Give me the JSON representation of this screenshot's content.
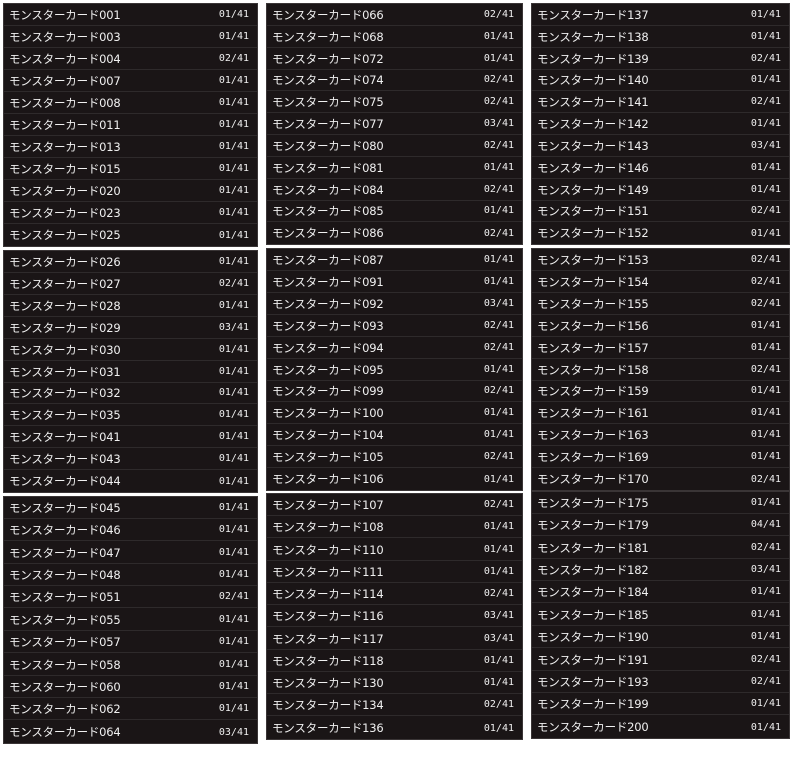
{
  "columns": [
    {
      "panels": [
        {
          "rows": [
            {
              "name": "モンスターカード001",
              "count": "01/41"
            },
            {
              "name": "モンスターカード003",
              "count": "01/41"
            },
            {
              "name": "モンスターカード004",
              "count": "02/41"
            },
            {
              "name": "モンスターカード007",
              "count": "01/41"
            },
            {
              "name": "モンスターカード008",
              "count": "01/41"
            },
            {
              "name": "モンスターカード011",
              "count": "01/41"
            },
            {
              "name": "モンスターカード013",
              "count": "01/41"
            },
            {
              "name": "モンスターカード015",
              "count": "01/41"
            },
            {
              "name": "モンスターカード020",
              "count": "01/41"
            },
            {
              "name": "モンスターカード023",
              "count": "01/41"
            },
            {
              "name": "モンスターカード025",
              "count": "01/41"
            }
          ]
        },
        {
          "rows": [
            {
              "name": "モンスターカード026",
              "count": "01/41"
            },
            {
              "name": "モンスターカード027",
              "count": "02/41"
            },
            {
              "name": "モンスターカード028",
              "count": "01/41"
            },
            {
              "name": "モンスターカード029",
              "count": "03/41"
            },
            {
              "name": "モンスターカード030",
              "count": "01/41"
            },
            {
              "name": "モンスターカード031",
              "count": "01/41"
            },
            {
              "name": "モンスターカード032",
              "count": "01/41"
            },
            {
              "name": "モンスターカード035",
              "count": "01/41"
            },
            {
              "name": "モンスターカード041",
              "count": "01/41"
            },
            {
              "name": "モンスターカード043",
              "count": "01/41"
            },
            {
              "name": "モンスターカード044",
              "count": "01/41"
            }
          ]
        },
        {
          "rows": [
            {
              "name": "モンスターカード045",
              "count": "01/41"
            },
            {
              "name": "モンスターカード046",
              "count": "01/41"
            },
            {
              "name": "モンスターカード047",
              "count": "01/41"
            },
            {
              "name": "モンスターカード048",
              "count": "01/41"
            },
            {
              "name": "モンスターカード051",
              "count": "02/41"
            },
            {
              "name": "モンスターカード055",
              "count": "01/41"
            },
            {
              "name": "モンスターカード057",
              "count": "01/41"
            },
            {
              "name": "モンスターカード058",
              "count": "01/41"
            },
            {
              "name": "モンスターカード060",
              "count": "01/41"
            },
            {
              "name": "モンスターカード062",
              "count": "01/41"
            },
            {
              "name": "モンスターカード064",
              "count": "03/41"
            }
          ]
        }
      ]
    },
    {
      "panels": [
        {
          "rows": [
            {
              "name": "モンスターカード066",
              "count": "02/41"
            },
            {
              "name": "モンスターカード068",
              "count": "01/41"
            },
            {
              "name": "モンスターカード072",
              "count": "01/41"
            },
            {
              "name": "モンスターカード074",
              "count": "02/41"
            },
            {
              "name": "モンスターカード075",
              "count": "02/41"
            },
            {
              "name": "モンスターカード077",
              "count": "03/41"
            },
            {
              "name": "モンスターカード080",
              "count": "02/41"
            },
            {
              "name": "モンスターカード081",
              "count": "01/41"
            },
            {
              "name": "モンスターカード084",
              "count": "02/41"
            },
            {
              "name": "モンスターカード085",
              "count": "01/41"
            },
            {
              "name": "モンスターカード086",
              "count": "02/41"
            }
          ]
        },
        {
          "rows": [
            {
              "name": "モンスターカード087",
              "count": "01/41"
            },
            {
              "name": "モンスターカード091",
              "count": "01/41"
            },
            {
              "name": "モンスターカード092",
              "count": "03/41"
            },
            {
              "name": "モンスターカード093",
              "count": "02/41"
            },
            {
              "name": "モンスターカード094",
              "count": "02/41"
            },
            {
              "name": "モンスターカード095",
              "count": "01/41"
            },
            {
              "name": "モンスターカード099",
              "count": "02/41"
            },
            {
              "name": "モンスターカード100",
              "count": "01/41"
            },
            {
              "name": "モンスターカード104",
              "count": "01/41"
            },
            {
              "name": "モンスターカード105",
              "count": "02/41"
            },
            {
              "name": "モンスターカード106",
              "count": "01/41"
            }
          ]
        },
        {
          "rows": [
            {
              "name": "モンスターカード107",
              "count": "02/41"
            },
            {
              "name": "モンスターカード108",
              "count": "01/41"
            },
            {
              "name": "モンスターカード110",
              "count": "01/41"
            },
            {
              "name": "モンスターカード111",
              "count": "01/41"
            },
            {
              "name": "モンスターカード114",
              "count": "02/41"
            },
            {
              "name": "モンスターカード116",
              "count": "03/41"
            },
            {
              "name": "モンスターカード117",
              "count": "03/41"
            },
            {
              "name": "モンスターカード118",
              "count": "01/41"
            },
            {
              "name": "モンスターカード130",
              "count": "01/41"
            },
            {
              "name": "モンスターカード134",
              "count": "02/41"
            },
            {
              "name": "モンスターカード136",
              "count": "01/41"
            }
          ]
        }
      ]
    },
    {
      "panels": [
        {
          "rows": [
            {
              "name": "モンスターカード137",
              "count": "01/41"
            },
            {
              "name": "モンスターカード138",
              "count": "01/41"
            },
            {
              "name": "モンスターカード139",
              "count": "02/41"
            },
            {
              "name": "モンスターカード140",
              "count": "01/41"
            },
            {
              "name": "モンスターカード141",
              "count": "02/41"
            },
            {
              "name": "モンスターカード142",
              "count": "01/41"
            },
            {
              "name": "モンスターカード143",
              "count": "03/41"
            },
            {
              "name": "モンスターカード146",
              "count": "01/41"
            },
            {
              "name": "モンスターカード149",
              "count": "01/41"
            },
            {
              "name": "モンスターカード151",
              "count": "02/41"
            },
            {
              "name": "モンスターカード152",
              "count": "01/41"
            }
          ]
        },
        {
          "rows": [
            {
              "name": "モンスターカード153",
              "count": "02/41"
            },
            {
              "name": "モンスターカード154",
              "count": "02/41"
            },
            {
              "name": "モンスターカード155",
              "count": "02/41"
            },
            {
              "name": "モンスターカード156",
              "count": "01/41"
            },
            {
              "name": "モンスターカード157",
              "count": "01/41"
            },
            {
              "name": "モンスターカード158",
              "count": "02/41"
            },
            {
              "name": "モンスターカード159",
              "count": "01/41"
            },
            {
              "name": "モンスターカード161",
              "count": "01/41"
            },
            {
              "name": "モンスターカード163",
              "count": "01/41"
            },
            {
              "name": "モンスターカード169",
              "count": "01/41"
            },
            {
              "name": "モンスターカード170",
              "count": "02/41"
            }
          ]
        },
        {
          "rows": [
            {
              "name": "モンスターカード175",
              "count": "01/41"
            },
            {
              "name": "モンスターカード179",
              "count": "04/41"
            },
            {
              "name": "モンスターカード181",
              "count": "02/41"
            },
            {
              "name": "モンスターカード182",
              "count": "03/41"
            },
            {
              "name": "モンスターカード184",
              "count": "01/41"
            },
            {
              "name": "モンスターカード185",
              "count": "01/41"
            },
            {
              "name": "モンスターカード190",
              "count": "01/41"
            },
            {
              "name": "モンスターカード191",
              "count": "02/41"
            },
            {
              "name": "モンスターカード193",
              "count": "02/41"
            },
            {
              "name": "モンスターカード199",
              "count": "01/41"
            },
            {
              "name": "モンスターカード200",
              "count": "01/41"
            }
          ]
        }
      ]
    }
  ]
}
